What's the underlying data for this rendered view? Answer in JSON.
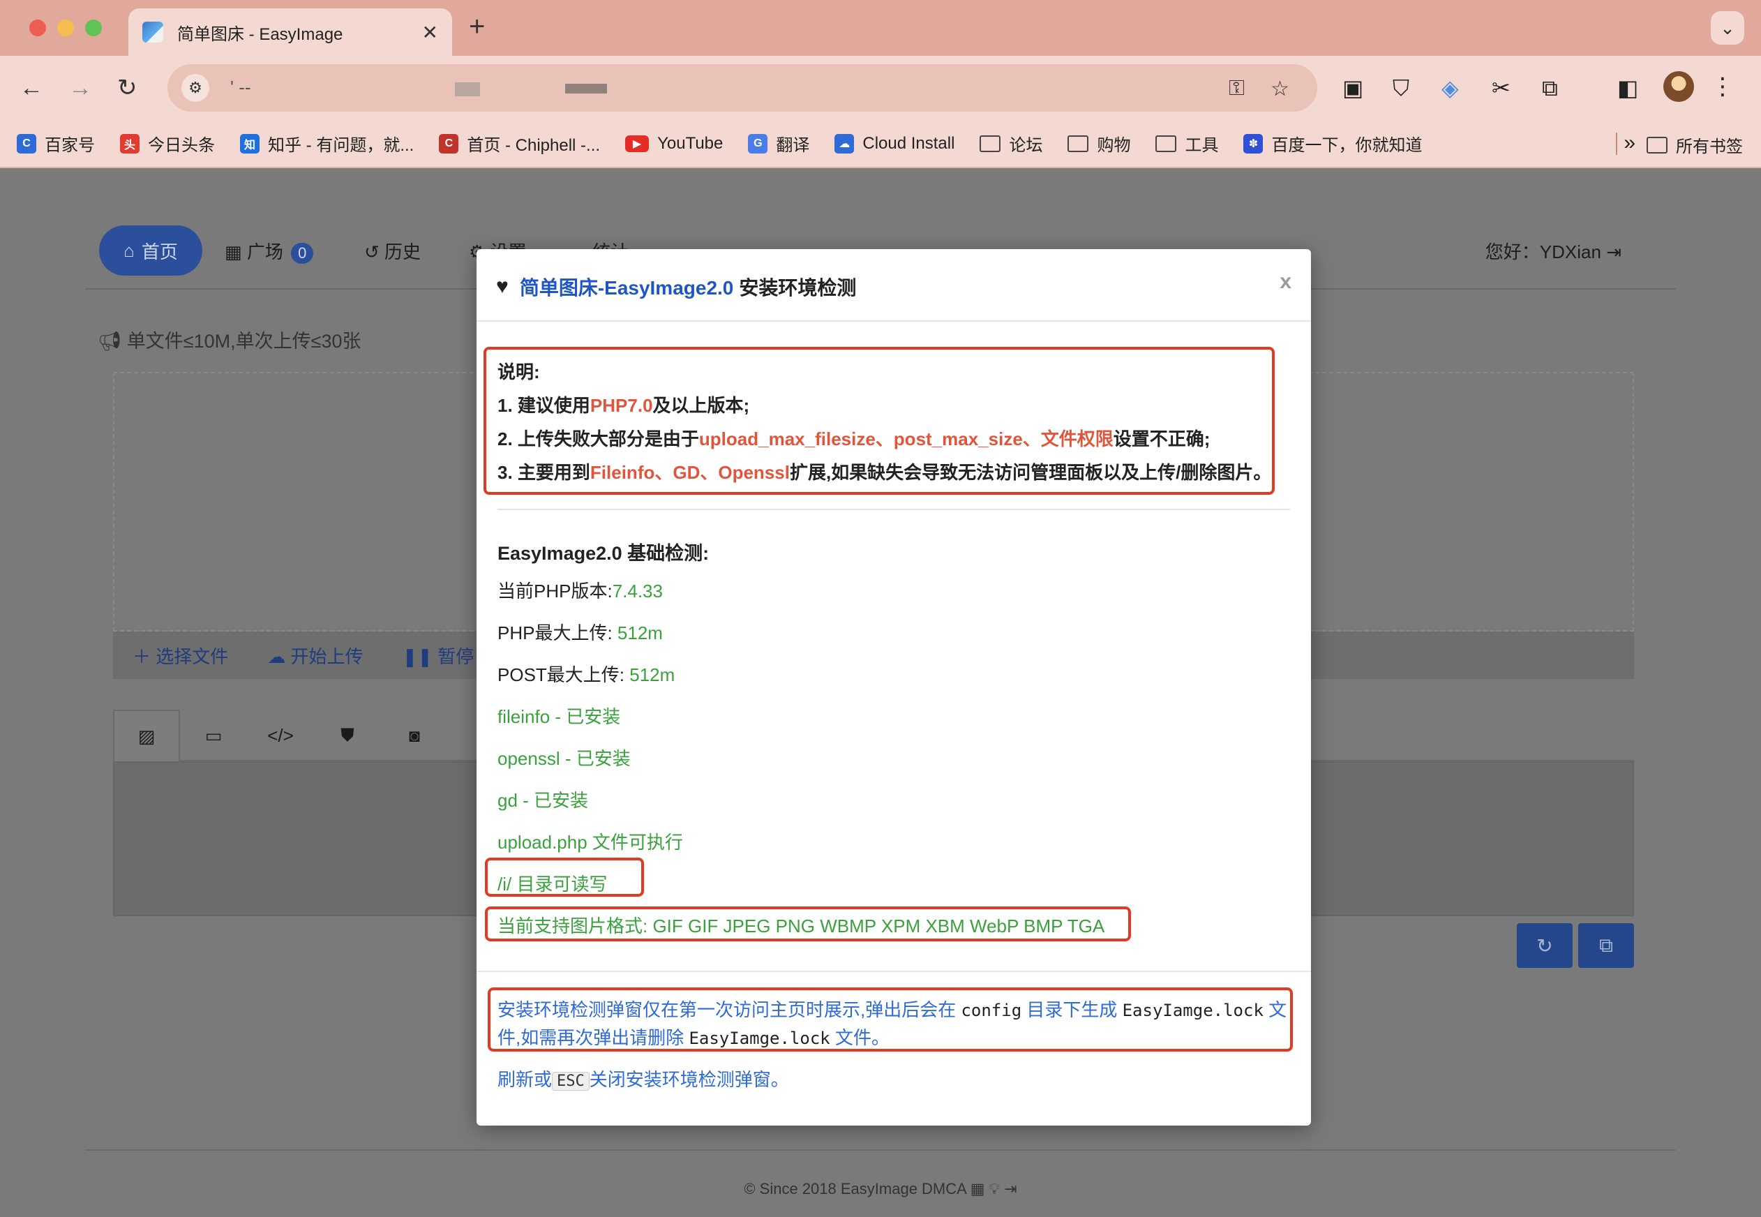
{
  "browser": {
    "tab_title": "简单图床 - EasyImage",
    "tab_close": "✕",
    "new_tab": "+",
    "tab_menu": "⌄",
    "back": "←",
    "forward": "→",
    "reload": "↻",
    "site_settings": "⚙",
    "url": "'  --",
    "key_icon": "⚿",
    "star_icon": "☆",
    "menu": "⋮"
  },
  "bookmarks": [
    {
      "label": "百家号",
      "icon_color": "#2f6bd6",
      "icon_text": "C"
    },
    {
      "label": "今日头条",
      "icon_color": "#e23b30",
      "icon_text": "头"
    },
    {
      "label": "知乎 - 有问题，就...",
      "icon_color": "#1e6fe0",
      "icon_text": "知"
    },
    {
      "label": "首页 - Chiphell -...",
      "icon_color": "#c0342d",
      "icon_text": "C"
    },
    {
      "label": "YouTube",
      "icon_color": "#e52d27",
      "icon_text": "▶"
    },
    {
      "label": "翻译",
      "icon_color": "#4a7de8",
      "icon_text": "G"
    },
    {
      "label": "Cloud Install",
      "icon_color": "#2f6bd6",
      "icon_text": "☁"
    }
  ],
  "bookmark_folders": [
    "论坛",
    "购物",
    "工具"
  ],
  "bookmark_baidu": "百度一下，你就知道",
  "bookmark_more": "»",
  "bookmark_all": "所有书签",
  "nav": {
    "home": "首页",
    "square": "广场",
    "square_count": "0",
    "history": "历史",
    "settings": "设置",
    "stats": "统计",
    "greeting": "您好：YDXian"
  },
  "notice": "单文件≤10M,单次上传≤30张",
  "upload": {
    "select": "选择文件",
    "start": "开始上传",
    "pause": "暂停"
  },
  "footer": "© Since 2018 EasyImage DMCA",
  "modal": {
    "brand": "简单图床-EasyImage2.0",
    "title_rest": "安装环境检测",
    "close": "x",
    "note_title": "说明:",
    "note1_a": "1. 建议使用",
    "note1_b": "PHP7.0",
    "note1_c": "及以上版本;",
    "note2_a": "2. 上传失败大部分是由于",
    "note2_b": "upload_max_filesize、post_max_size、文件权限",
    "note2_c": "设置不正确;",
    "note3_a": "3. 主要用到",
    "note3_b": "Fileinfo、GD、Openssl",
    "note3_c": "扩展,如果缺失会导致无法访问管理面板以及上传/删除图片。",
    "check_title": "EasyImage2.0 基础检测:",
    "php_version_label": "当前PHP版本:",
    "php_version": "7.4.33",
    "php_upload_label": "PHP最大上传: ",
    "php_upload": "512m",
    "post_upload_label": "POST最大上传: ",
    "post_upload": "512m",
    "fileinfo": "fileinfo - 已安装",
    "openssl": "openssl - 已安装",
    "gd": "gd - 已安装",
    "upload_php": "upload.php 文件可执行",
    "dir_rw": "/i/ 目录可读写",
    "formats": "当前支持图片格式: GIF GIF JPEG PNG WBMP XPM XBM WebP BMP TGA",
    "tip1_a": "安装环境检测弹窗仅在第一次访问主页时展示,弹出后会在 ",
    "tip1_code1": "config",
    "tip1_b": " 目录下生成 ",
    "tip1_code2": "EasyIamge.lock",
    "tip1_c": " 文",
    "tip2_a": "件,如需再次弹出请删除 ",
    "tip2_code": "EasyIamge.lock",
    "tip2_b": " 文件。",
    "tip3_a": "刷新或",
    "tip3_kbd": "ESC",
    "tip3_b": "关闭安装环境检测弹窗。"
  }
}
